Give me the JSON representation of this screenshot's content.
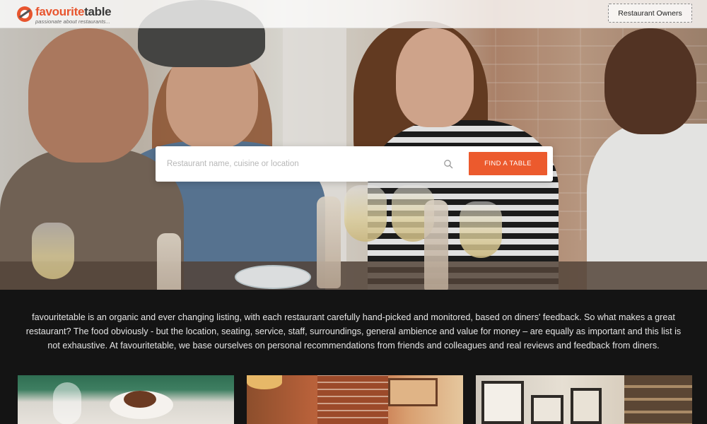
{
  "header": {
    "logo": {
      "word_part1": "favourite",
      "word_part2": "table",
      "tagline": "passionate about restaurants..."
    },
    "owners_button": "Restaurant Owners"
  },
  "search": {
    "placeholder": "Restaurant name, cuisine or location",
    "value": "",
    "button_label": "FIND A TABLE"
  },
  "intro": {
    "text": "favouritetable is an organic and ever changing listing, with each restaurant carefully hand-picked and monitored, based on diners' feedback. So what makes a great restaurant? The food obviously - but the location, seating, service, staff, surroundings, general ambience and value for money – are equally as important and this list is not exhaustive. At favouritetable, we base ourselves on personal recommendations from friends and colleagues and real reviews and feedback from diners."
  },
  "colors": {
    "brand": "#e8552e",
    "find_button": "#ec5a2d",
    "intro_bg": "#141414"
  },
  "icons": [
    "logo-mark-icon",
    "search-icon"
  ]
}
